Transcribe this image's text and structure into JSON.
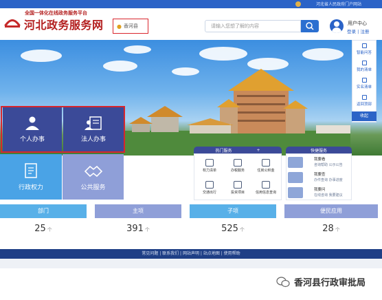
{
  "top_bar": {
    "gov_link": "河北省人民政府门户网站"
  },
  "header": {
    "logo_sub": "全国一体化在线政务服务平台",
    "logo_main": "河北政务服务网",
    "location": "香河县",
    "search_placeholder": "请输入您想了解的内容",
    "user_center": "用户中心",
    "login": "登录",
    "separator": "|",
    "register": "注册"
  },
  "service_tiles": {
    "personal": "个人办事",
    "legal": "法人办事",
    "power": "行政权力",
    "public": "公共服务"
  },
  "sidebar": {
    "items": [
      "智能问答",
      "我的清单",
      "实名清单",
      "返回顶部"
    ],
    "collapse": "收起"
  },
  "hot_panel": {
    "title": "热门服务",
    "plus": "+",
    "items": [
      "权力清单",
      "办税服务",
      "住房公积金",
      "交通出行",
      "投资项目",
      "信用信息查询"
    ]
  },
  "quick_panel": {
    "title": "快捷服务",
    "rows": [
      {
        "title": "我要看",
        "sub": "咨询帮助    公示公告"
      },
      {
        "title": "我要查",
        "sub": "办件查询    办事进度"
      },
      {
        "title": "我要问",
        "sub": "在线咨询    我要建议"
      }
    ]
  },
  "stats": [
    {
      "label": "部门",
      "value": "25",
      "unit": "个"
    },
    {
      "label": "主项",
      "value": "391",
      "unit": "个"
    },
    {
      "label": "子项",
      "value": "525",
      "unit": "个"
    },
    {
      "label": "便民应用",
      "value": "28",
      "unit": "个"
    }
  ],
  "colors": {
    "brand_red": "#b31e1e",
    "primary_blue": "#2b63c7",
    "tile_dark": "#3b4a98",
    "tile_light": "#4aa3e6",
    "stat_blue": "#58b0e8",
    "stat_purple": "#8f9fd8"
  },
  "footer": {
    "links": "常见问题 | 联系我们 | 网站声明 | 站点地图 | 使用帮助"
  },
  "watermark": {
    "text": "香河县行政审批局"
  }
}
